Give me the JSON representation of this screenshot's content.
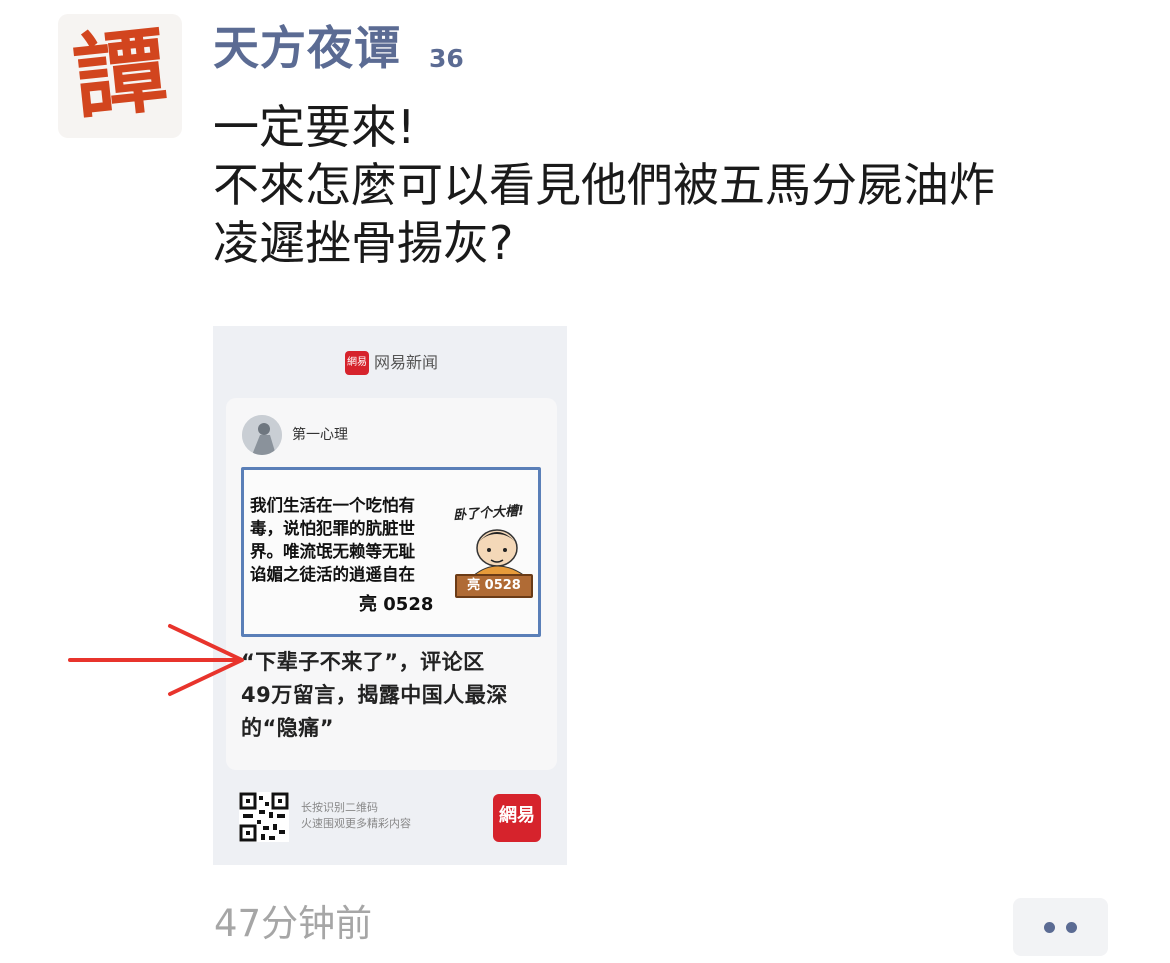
{
  "post": {
    "avatar_text": "譚",
    "username": "天方夜谭",
    "username_badge": "36",
    "text_lines": [
      "一定要來!",
      "不來怎麼可以看見他們被五馬分屍油炸",
      "凌遲挫骨揚灰?"
    ],
    "timestamp": "47分钟前"
  },
  "shared_image": {
    "source_logo": "網易",
    "source_name": "网易新闻",
    "card_author": "第一心理",
    "quote_lines": [
      "我们生活在一个吃怕有",
      "毒，说怕犯罪的肮脏世",
      "界。唯流氓无赖等无耻",
      "谄媚之徒活的逍遥自在"
    ],
    "quote_code": "亮 0528",
    "figure_caption": "卧了个大槽!",
    "figure_sign": "亮 0528",
    "headline_lines": [
      "“下辈子不来了”，评论区",
      "49万留言，揭露中国人最深",
      "的“隐痛”"
    ],
    "footer_hint_lines": [
      "长按识别二维码",
      "火速围观更多精彩内容"
    ],
    "footer_logo": "網易"
  },
  "colors": {
    "username": "#5b6b93",
    "arrow": "#e8342c",
    "brand_red": "#d6232c",
    "timestamp": "#a6a6a6"
  },
  "icons": {
    "more": "ellipsis-two-dots-icon",
    "arrow": "red-arrow-annotation"
  }
}
